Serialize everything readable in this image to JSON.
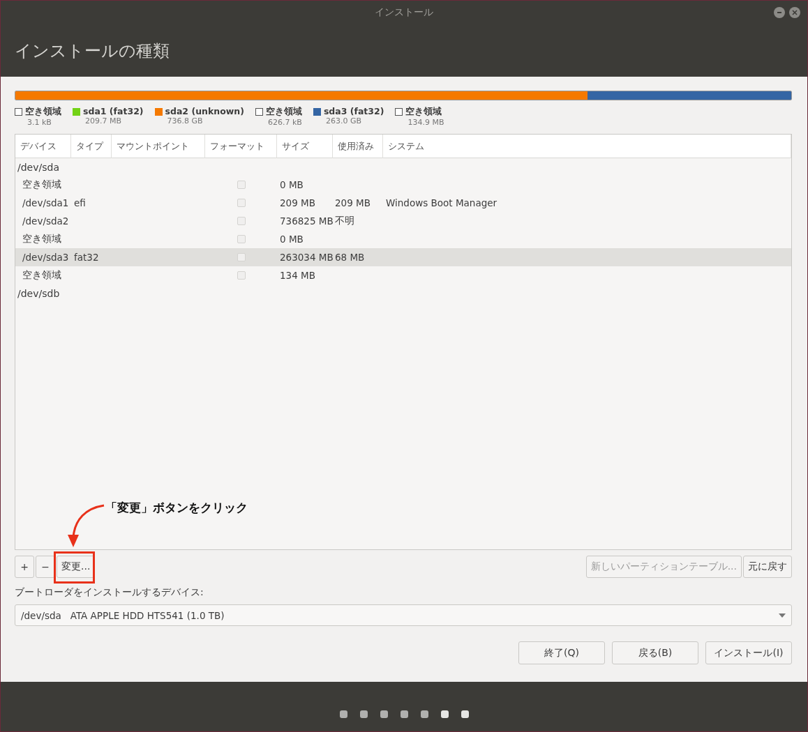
{
  "window": {
    "title": "インストール"
  },
  "header": {
    "title": "インストールの種類"
  },
  "disk_bar": [
    {
      "name": "空き領域",
      "size": "3.1 kB",
      "color": "#ffffff"
    },
    {
      "name": "sda1 (fat32)",
      "size": "209.7 MB",
      "color": "#73d216"
    },
    {
      "name": "sda2 (unknown)",
      "size": "736.8 GB",
      "color": "#f57900",
      "level": 0.737
    },
    {
      "name": "空き領域",
      "size": "626.7 kB",
      "color": "#ffffff"
    },
    {
      "name": "sda3 (fat32)",
      "size": "263.0 GB",
      "color": "#3465a4",
      "level": 0.263
    },
    {
      "name": "空き領域",
      "size": "134.9 MB",
      "color": "#ffffff"
    }
  ],
  "table": {
    "columns": [
      "デバイス",
      "タイプ",
      "マウントポイント",
      "フォーマット",
      "サイズ",
      "使用済み",
      "システム"
    ],
    "rows": [
      {
        "kind": "disk",
        "device": "/dev/sda",
        "selected": false
      },
      {
        "kind": "partition",
        "device": "空き領域",
        "format": false,
        "size": "0 MB",
        "selected": false
      },
      {
        "kind": "partition",
        "device": "/dev/sda1",
        "type": "efi",
        "format": false,
        "size": "209 MB",
        "used": "209 MB",
        "system": "Windows Boot Manager",
        "selected": false
      },
      {
        "kind": "partition",
        "device": "/dev/sda2",
        "format": false,
        "size": "736825 MB",
        "used": "不明",
        "selected": false
      },
      {
        "kind": "partition",
        "device": "空き領域",
        "format": false,
        "size": "0 MB",
        "selected": false
      },
      {
        "kind": "partition",
        "device": "/dev/sda3",
        "type": "fat32",
        "format": false,
        "size": "263034 MB",
        "used": "68 MB",
        "selected": true
      },
      {
        "kind": "partition",
        "device": "空き領域",
        "format": false,
        "size": "134 MB",
        "selected": false
      },
      {
        "kind": "disk",
        "device": "/dev/sdb",
        "selected": false
      }
    ]
  },
  "toolbar": {
    "add": "+",
    "remove": "−",
    "change": "変更...",
    "new_table": "新しいパーティションテーブル...",
    "revert": "元に戻す",
    "new_table_disabled": true
  },
  "bootloader": {
    "label": "ブートローダをインストールするデバイス:",
    "value": "/dev/sda   ATA APPLE HDD HTS541 (1.0 TB)"
  },
  "buttons": [
    "終了(Q)",
    "戻る(B)",
    "インストール(I)"
  ],
  "annotation": {
    "text": "「変更」ボタンをクリック"
  },
  "progress_dots": [
    {
      "lit": false
    },
    {
      "lit": false
    },
    {
      "lit": false
    },
    {
      "lit": false
    },
    {
      "lit": false
    },
    {
      "lit": true
    },
    {
      "lit": true
    }
  ]
}
